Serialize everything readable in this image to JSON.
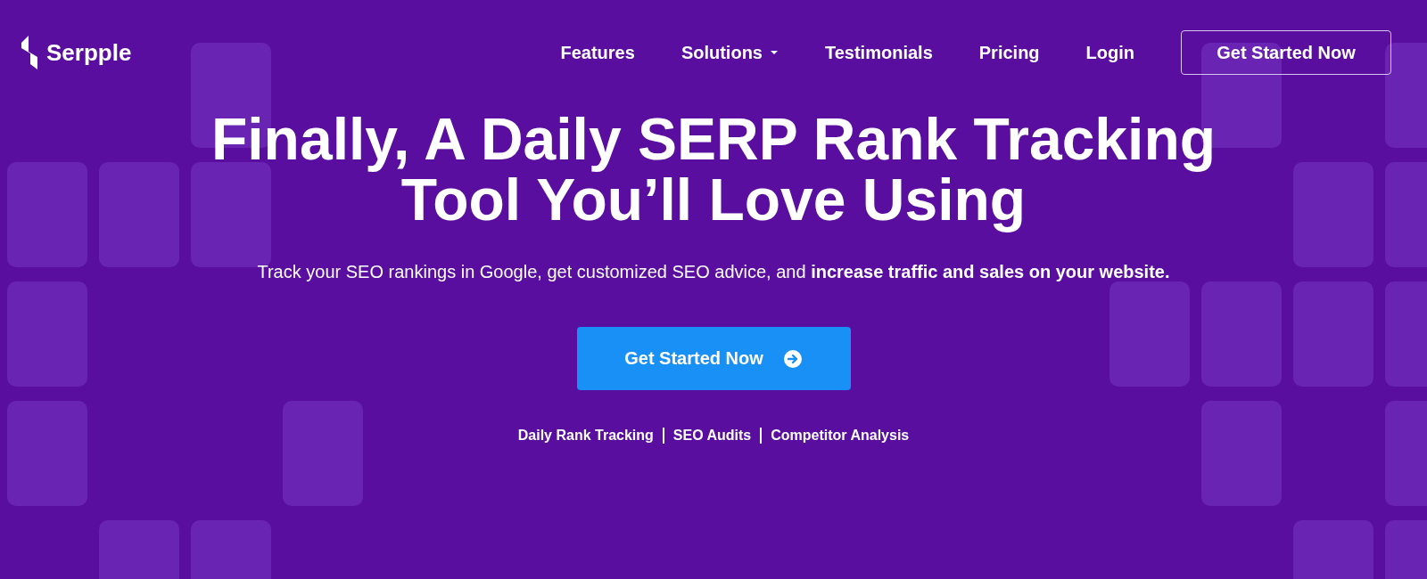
{
  "header": {
    "logo": "Serpple",
    "nav": [
      {
        "label": "Features",
        "kind": "link"
      },
      {
        "label": "Solutions",
        "kind": "dropdown"
      },
      {
        "label": "Testimonials",
        "kind": "link"
      },
      {
        "label": "Pricing",
        "kind": "link"
      },
      {
        "label": "Login",
        "kind": "link"
      }
    ],
    "cta": "Get Started Now"
  },
  "hero": {
    "headline_lines": [
      "Finally, A Daily SERP Rank Tracking",
      "Tool You’ll Love Using"
    ],
    "subtitle": "Track your SEO rankings in Google, get customized SEO advice, and **increase traffic and sales on your website.**",
    "button": "Get Started Now",
    "features": [
      "Daily Rank Tracking",
      "SEO Audits",
      "Competitor Analysis"
    ]
  }
}
